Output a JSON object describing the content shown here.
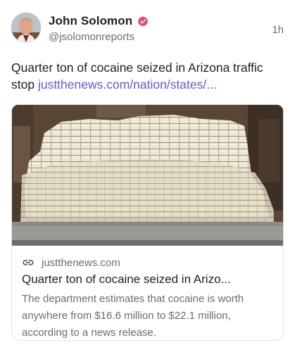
{
  "author": {
    "display_name": "John Solomon",
    "handle": "@jsolomonreports",
    "verified_icon": "verified-badge-icon",
    "avatar_icon": "avatar-photo"
  },
  "post": {
    "time": "1h",
    "text": "Quarter ton of cocaine seized in Arizona traffic stop ",
    "link_text": "justthenews.com/nation/states/..."
  },
  "card": {
    "image_icon": "stacked-packages-photo",
    "domain_icon": "link-icon",
    "domain": "justthenews.com",
    "title": "Quarter ton of cocaine seized in Arizo...",
    "description": "The department estimates that cocaine is worth anywhere from $16.6 million to $22.1 million, according to a news release."
  },
  "colors": {
    "accent": "#5f5bd6",
    "verified": "#e8476f",
    "muted_text": "#6b6b76",
    "primary_text": "#1f1f24"
  }
}
